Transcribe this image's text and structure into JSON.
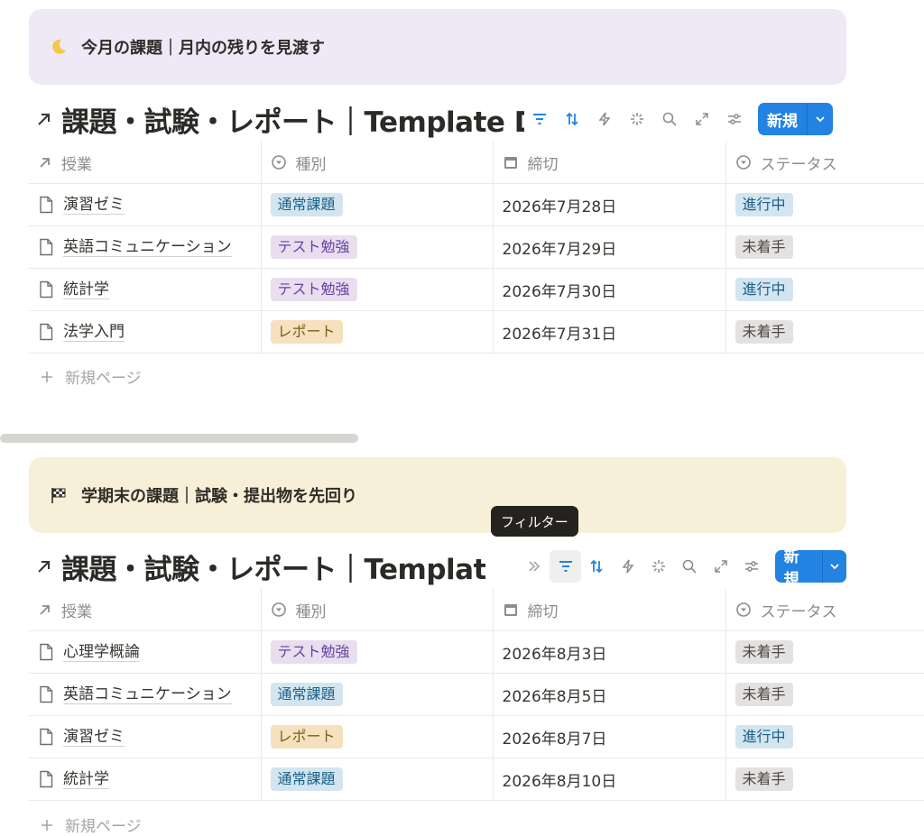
{
  "sections": [
    {
      "callout": {
        "icon": "crescent-moon-emoji",
        "text": "今月の課題｜月内の残りを見渡す"
      },
      "db_title": "課題・試験・レポート｜Template Database",
      "columns": [
        "授業",
        "種別",
        "締切",
        "ステータス"
      ],
      "rows": [
        {
          "name": "演習ゼミ",
          "type": "通常課題",
          "type_color": "blue",
          "due": "2026年7月28日",
          "status": "進行中",
          "status_color": "blue"
        },
        {
          "name": "英語コミュニケーション",
          "type": "テスト勉強",
          "type_color": "purple",
          "due": "2026年7月29日",
          "status": "未着手",
          "status_color": "gray"
        },
        {
          "name": "統計学",
          "type": "テスト勉強",
          "type_color": "purple",
          "due": "2026年7月30日",
          "status": "進行中",
          "status_color": "blue"
        },
        {
          "name": "法学入門",
          "type": "レポート",
          "type_color": "yellow",
          "due": "2026年7月31日",
          "status": "未着手",
          "status_color": "gray"
        }
      ],
      "add_label": "新規ページ"
    },
    {
      "callout": {
        "icon": "checkered-flag-emoji",
        "text": "学期末の課題｜試験・提出物を先回り"
      },
      "db_title": "課題・試験・レポート｜Template Database",
      "columns": [
        "授業",
        "種別",
        "締切",
        "ステータス"
      ],
      "rows": [
        {
          "name": "心理学概論",
          "type": "テスト勉強",
          "type_color": "purple",
          "due": "2026年8月3日",
          "status": "未着手",
          "status_color": "gray"
        },
        {
          "name": "英語コミュニケーション",
          "type": "通常課題",
          "type_color": "blue",
          "due": "2026年8月5日",
          "status": "未着手",
          "status_color": "gray"
        },
        {
          "name": "演習ゼミ",
          "type": "レポート",
          "type_color": "yellow",
          "due": "2026年8月7日",
          "status": "進行中",
          "status_color": "blue"
        },
        {
          "name": "統計学",
          "type": "通常課題",
          "type_color": "blue",
          "due": "2026年8月10日",
          "status": "未着手",
          "status_color": "gray"
        }
      ],
      "add_label": "新規ページ"
    }
  ],
  "toolbar": {
    "new_label": "新規"
  },
  "tooltip": "フィルター",
  "colors": {
    "accent": "#2383e2",
    "callout1_bg": "#efe8f6",
    "callout2_bg": "#f8efd9"
  }
}
